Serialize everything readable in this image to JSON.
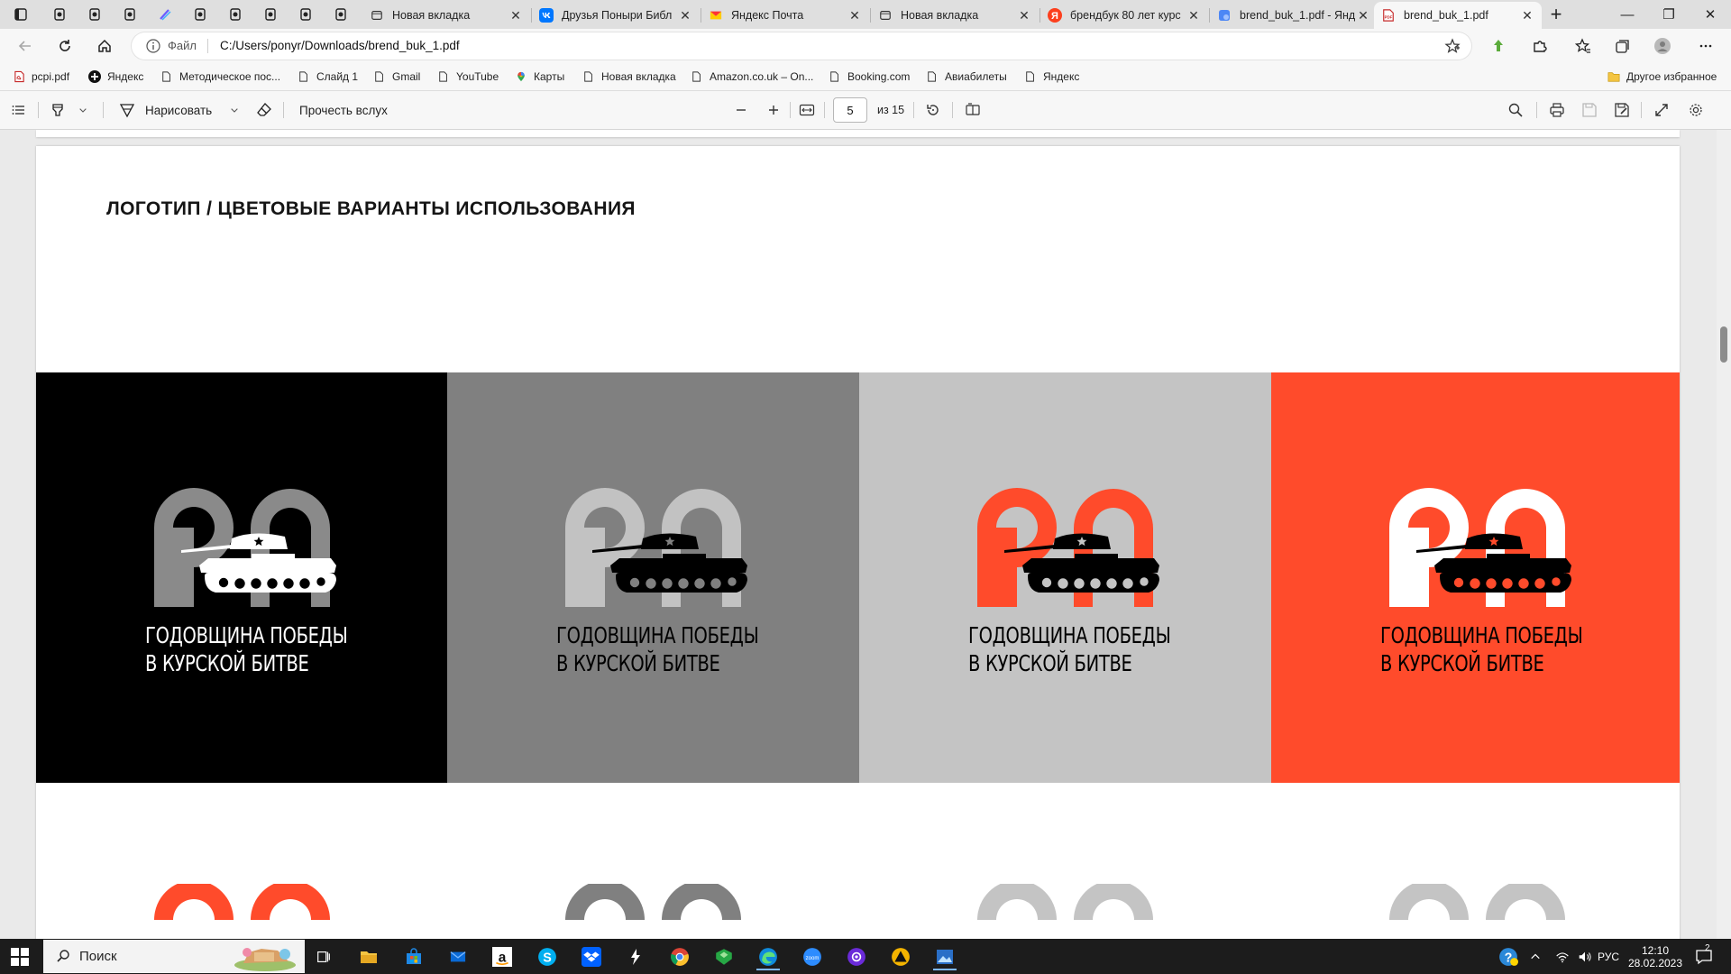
{
  "browser": {
    "tabs": [
      {
        "title": "Новая вкладка",
        "icon": "new-tab-icon",
        "active": false
      },
      {
        "title": "Друзья Поныри Библ",
        "icon": "vk-icon",
        "active": false
      },
      {
        "title": "Яндекс Почта",
        "icon": "yandex-mail-icon",
        "active": false
      },
      {
        "title": "Новая вкладка",
        "icon": "new-tab-icon",
        "active": false
      },
      {
        "title": "брендбук 80 лет курс",
        "icon": "yandex-icon",
        "active": false
      },
      {
        "title": "brend_buk_1.pdf - Янд",
        "icon": "yandex-docs-icon",
        "active": false
      },
      {
        "title": "brend_buk_1.pdf",
        "icon": "pdf-icon",
        "active": true
      }
    ],
    "tab_close_glyph": "✕",
    "new_tab_glyph": "+",
    "window_controls": {
      "minimize": "—",
      "restore": "❐",
      "close": "✕"
    },
    "address": {
      "scheme_label": "Файл",
      "url": "C:/Users/ponyr/Downloads/brend_buk_1.pdf"
    },
    "bookmarks": [
      {
        "label": "pcpi.pdf",
        "icon": "pdf-icon"
      },
      {
        "label": "Яндекс",
        "icon": "yandex-plus-icon"
      },
      {
        "label": "Методическое пос...",
        "icon": "page-icon"
      },
      {
        "label": "Слайд 1",
        "icon": "page-icon"
      },
      {
        "label": "Gmail",
        "icon": "page-icon"
      },
      {
        "label": "YouTube",
        "icon": "page-icon"
      },
      {
        "label": "Карты",
        "icon": "maps-pin-icon"
      },
      {
        "label": "Новая вкладка",
        "icon": "page-icon"
      },
      {
        "label": "Amazon.co.uk – On...",
        "icon": "page-icon"
      },
      {
        "label": "Booking.com",
        "icon": "page-icon"
      },
      {
        "label": "Авиабилеты",
        "icon": "page-icon"
      },
      {
        "label": "Яндекс",
        "icon": "page-icon"
      }
    ],
    "other_favorites": "Другое избранное"
  },
  "pdf_toolbar": {
    "draw_label": "Нарисовать",
    "read_aloud_label": "Прочесть вслух",
    "page_current": "5",
    "page_total": "из 15"
  },
  "document": {
    "heading": "ЛОГОТИП / ЦВЕТОВЫЕ ВАРИАНТЫ ИСПОЛЬЗОВАНИЯ",
    "logo_number": "80",
    "logo_line1": "ГОДОВЩИНА ПОБЕДЫ",
    "logo_line2": "В КУРСКОЙ БИТВЕ",
    "variants": [
      {
        "background": "#000000",
        "numeral": "#8a8a8a",
        "tank": "#ffffff",
        "text": "#ffffff"
      },
      {
        "background": "#808080",
        "numeral": "#c2c2c2",
        "tank": "#000000",
        "text": "#000000"
      },
      {
        "background": "#c4c4c4",
        "numeral": "#ff4b2b",
        "tank": "#000000",
        "text": "#000000"
      },
      {
        "background": "#ff4b2b",
        "numeral": "#ffffff",
        "tank": "#000000",
        "text": "#000000"
      }
    ],
    "next_row_colors": [
      "#ff4b2b",
      "#808080",
      "#c4c4c4",
      "#c4c4c4"
    ]
  },
  "taskbar": {
    "search_label": "Поиск",
    "language": "РУС",
    "time": "12:10",
    "date": "28.02.2023",
    "notification_count": "2"
  },
  "colors": {
    "accent_red": "#ff4b2b"
  }
}
